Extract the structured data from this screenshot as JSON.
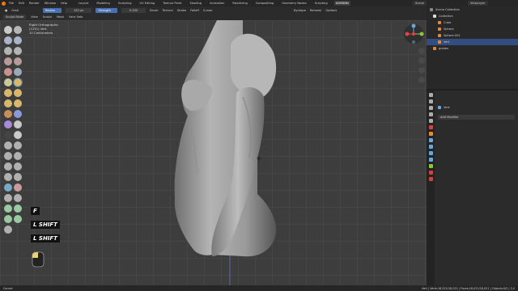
{
  "topbar": {
    "menus": [
      "File",
      "Edit",
      "Render",
      "Window",
      "Help"
    ],
    "workspaces": [
      "Layout",
      "Modeling",
      "Sculpting",
      "UV Editing",
      "Texture Paint",
      "Shading",
      "Animation",
      "Rendering",
      "Compositing",
      "Geometry Nodes",
      "Scripting",
      "ADHDNN"
    ],
    "active_workspace": "ADHDNN",
    "scene": "Scene",
    "view_layer": "ViewLayer"
  },
  "header": {
    "tool": "Grab",
    "radius_label": "Radius",
    "radius_value": "150 px",
    "strength_label": "Strength",
    "strength_value": "0.400",
    "menus": [
      "Brush",
      "Texture",
      "Stroke",
      "Falloff",
      "Cursor"
    ],
    "right": [
      "Dyntopo",
      "Remesh",
      "Options"
    ]
  },
  "header2": {
    "mode": "Sculpt Mode",
    "menus": [
      "View",
      "Sculpt",
      "Mask",
      "Face Sets"
    ]
  },
  "viewport": {
    "info": [
      "Right Orthographic",
      "(1251) Vert",
      "10 Centimeters"
    ],
    "keys": [
      "F",
      "L SHIFT",
      "L SHIFT"
    ]
  },
  "outliner": {
    "title": "Scene Collection",
    "rows": [
      "Collection",
      "Cube",
      "Sphere",
      "Sphere.001",
      "Vert",
      "guides"
    ],
    "selected": "Vert"
  },
  "properties": {
    "object": "Vert",
    "add_modifier": "Add Modifier"
  },
  "status": {
    "left": "Cancel",
    "right": "Vert | Verts:18,021/18,021 | Faces:18,021/18,021 | Objects:0/2 | 3.0"
  },
  "colors": {
    "accent_blue": "#4772b3",
    "brand_orange": "#e87d0d",
    "viewport_bg": "#3d3d3d"
  }
}
